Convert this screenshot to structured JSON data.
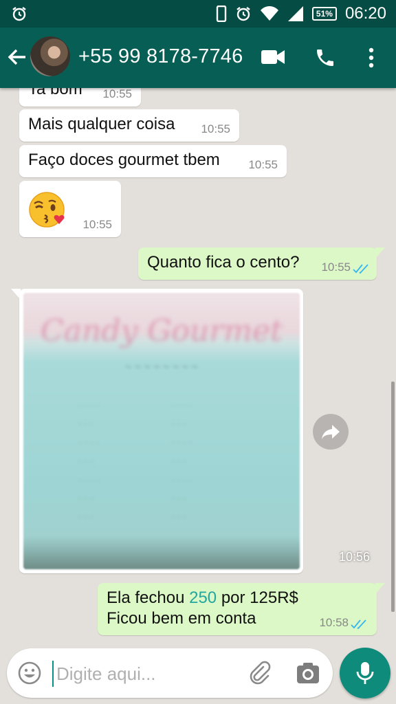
{
  "status_bar": {
    "time": "06:20",
    "battery": "51%",
    "icons": [
      "alarm-icon",
      "phone-icon",
      "alarm-clock-icon",
      "wifi-icon",
      "signal-icon",
      "battery-icon"
    ]
  },
  "header": {
    "contact_name": "+55 99 8178-7746",
    "icons": [
      "back-arrow-icon",
      "video-call-icon",
      "phone-call-icon",
      "more-vert-icon"
    ]
  },
  "messages": [
    {
      "direction": "in",
      "text": "Ta bom",
      "time": "10:55"
    },
    {
      "direction": "in",
      "text": "Mais qualquer coisa",
      "time": "10:55"
    },
    {
      "direction": "in",
      "text": "Faço doces gourmet tbem",
      "time": "10:55"
    },
    {
      "direction": "in",
      "emoji": "winking-kiss-emoji",
      "time": "10:55"
    },
    {
      "direction": "out",
      "text": "Quanto fica o cento?",
      "time": "10:55",
      "status": "read"
    },
    {
      "direction": "in",
      "image": true,
      "image_title": "Candy Gourmet",
      "time": "10:56"
    },
    {
      "direction": "out",
      "lines": [
        "Ela fechou",
        "250",
        "por 125R$",
        "Ficou bem em conta"
      ],
      "time": "10:58",
      "status": "read"
    }
  ],
  "input": {
    "placeholder": "Digite aqui...",
    "value": ""
  },
  "colors": {
    "status_bar": "#054d44",
    "app_bar": "#075e54",
    "outgoing_bubble": "#dcf8c6",
    "incoming_bubble": "#ffffff",
    "chat_background": "#e3dfda",
    "read_ticks": "#34b7f1",
    "accent": "#0f8b7c",
    "link": "#23a6a0"
  }
}
